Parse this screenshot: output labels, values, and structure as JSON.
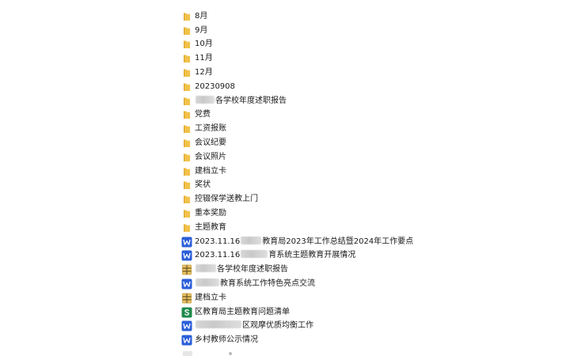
{
  "colors": {
    "folder": "#f2c24a",
    "folder_dark": "#d9a52f",
    "word": "#2b5fd9",
    "sheet": "#1f8a4c",
    "archive": "#c99b2e"
  },
  "items": [
    {
      "type": "folder",
      "icon": "folder-icon",
      "label": "8月"
    },
    {
      "type": "folder",
      "icon": "folder-icon",
      "label": "9月"
    },
    {
      "type": "folder",
      "icon": "folder-icon",
      "label": "10月"
    },
    {
      "type": "folder",
      "icon": "folder-icon",
      "label": "11月"
    },
    {
      "type": "folder",
      "icon": "folder-icon",
      "label": "12月"
    },
    {
      "type": "folder",
      "icon": "folder-icon",
      "label": "20230908"
    },
    {
      "type": "folder",
      "icon": "folder-icon",
      "label_prefix": "",
      "label": "各学校年度述职报告",
      "redacted": true
    },
    {
      "type": "folder",
      "icon": "folder-icon",
      "label": "党费"
    },
    {
      "type": "folder",
      "icon": "folder-icon",
      "label": "工资报账"
    },
    {
      "type": "folder",
      "icon": "folder-icon",
      "label": "会议纪要"
    },
    {
      "type": "folder",
      "icon": "folder-icon",
      "label": "会议照片"
    },
    {
      "type": "folder",
      "icon": "folder-icon",
      "label": "建档立卡"
    },
    {
      "type": "folder",
      "icon": "folder-icon",
      "label": "奖状"
    },
    {
      "type": "folder",
      "icon": "folder-icon",
      "label": "控辍保学送教上门"
    },
    {
      "type": "folder",
      "icon": "folder-icon",
      "label": "重本奖励"
    },
    {
      "type": "folder",
      "icon": "folder-icon",
      "label": "主题教育"
    },
    {
      "type": "word",
      "icon": "word-doc-icon",
      "label_prefix": "2023.11.16",
      "label": "教育局2023年工作总结暨2024年工作要点",
      "redacted": true
    },
    {
      "type": "word",
      "icon": "word-doc-icon",
      "label_prefix": "2023.11.16",
      "label": "育系统主题教育开展情况",
      "redacted": true
    },
    {
      "type": "archive",
      "icon": "archive-icon",
      "label_prefix": "",
      "label": "各学校年度述职报告",
      "redacted": true
    },
    {
      "type": "word",
      "icon": "word-doc-icon",
      "label_prefix": "",
      "label": "教育系统工作特色亮点交流",
      "redacted": true
    },
    {
      "type": "archive",
      "icon": "archive-icon",
      "label": "建档立卡"
    },
    {
      "type": "sheet",
      "icon": "spreadsheet-icon",
      "label": "区教育局主题教育问题清单"
    },
    {
      "type": "word",
      "icon": "word-doc-icon",
      "label_prefix": "",
      "label": "区观摩优质均衡工作",
      "redacted": true
    },
    {
      "type": "word",
      "icon": "word-doc-icon",
      "label": "乡村教师公示情况"
    }
  ]
}
